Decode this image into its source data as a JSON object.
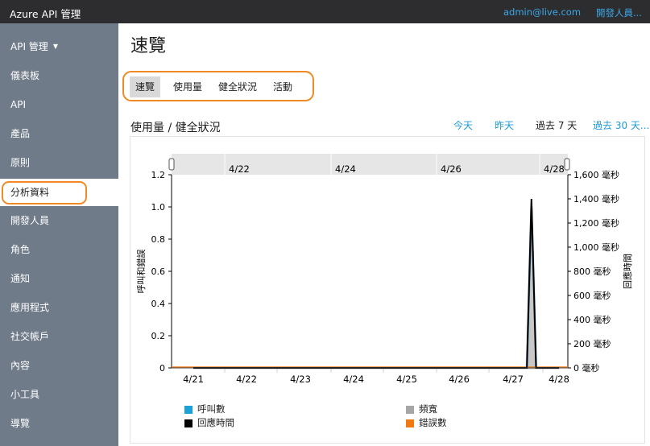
{
  "topbar": {
    "app_title": "Azure API 管理",
    "user_email": "admin@live.com",
    "developer_link": "開發人員..."
  },
  "sidebar": {
    "items": [
      {
        "label": "API 管理",
        "has_caret": true
      },
      {
        "label": "儀表板"
      },
      {
        "label": "API"
      },
      {
        "label": "產品"
      },
      {
        "label": "原則"
      },
      {
        "label": "分析資料",
        "active": true
      },
      {
        "label": "開發人員"
      },
      {
        "label": "角色"
      },
      {
        "label": "通知"
      },
      {
        "label": "應用程式"
      },
      {
        "label": "社交帳戶"
      },
      {
        "label": "內容"
      },
      {
        "label": "小工具"
      },
      {
        "label": "導覽"
      }
    ]
  },
  "main": {
    "page_title": "速覽",
    "tabs": [
      {
        "label": "速覽",
        "selected": true
      },
      {
        "label": "使用量"
      },
      {
        "label": "健全狀況"
      },
      {
        "label": "活動"
      }
    ],
    "section_title": "使用量 / 健全狀況",
    "time_ranges": [
      {
        "label": "今天"
      },
      {
        "label": "昨天"
      },
      {
        "label": "過去 7 天",
        "selected": true
      },
      {
        "label": "過去 30 天..."
      }
    ]
  },
  "colors": {
    "accent_highlight": "#f08a24",
    "link": "#1f9bd7",
    "sidebar_bg": "#6f7b88",
    "topbar_bg": "#2d2d30"
  },
  "chart_data": {
    "type": "line",
    "ylabel": "呼叫和錯誤",
    "y2label": "回應時間",
    "ylim": [
      0,
      1.2
    ],
    "y2lim": [
      0,
      1600
    ],
    "yticks": [
      "0",
      "0.2",
      "0.4",
      "0.6",
      "0.8",
      "1.0",
      "1.2"
    ],
    "y2ticks": [
      "0 毫秒",
      "200 毫秒",
      "400 毫秒",
      "600 毫秒",
      "800 毫秒",
      "1,000 毫秒",
      "1,200 毫秒",
      "1,400 毫秒",
      "1,600 毫秒"
    ],
    "xticks": [
      "4/21",
      "4/22",
      "4/23",
      "4/24",
      "4/25",
      "4/26",
      "4/27",
      "4/28"
    ],
    "navigator_ticks": [
      "4/22",
      "4/24",
      "4/26",
      "4/28"
    ],
    "series": [
      {
        "name": "呼叫數",
        "color": "#1aa1d6",
        "x": [
          21.0,
          27.3,
          27.4,
          27.5,
          28.0
        ],
        "values": [
          0,
          0,
          1.0,
          0,
          0
        ]
      },
      {
        "name": "回應時間",
        "color": "#000000",
        "x": [
          21.0,
          27.3,
          27.4,
          27.5,
          28.0
        ],
        "values": [
          0,
          0,
          1400,
          0,
          0
        ]
      },
      {
        "name": "頻寬",
        "color": "#a6a6a6",
        "x": [
          21.0,
          27.3,
          27.4,
          27.5,
          28.0
        ],
        "values": [
          0,
          0,
          1.0,
          0,
          0
        ]
      },
      {
        "name": "錯誤數",
        "color": "#f07a10",
        "x": [
          21.0,
          28.0
        ],
        "values": [
          0,
          0
        ]
      }
    ]
  }
}
